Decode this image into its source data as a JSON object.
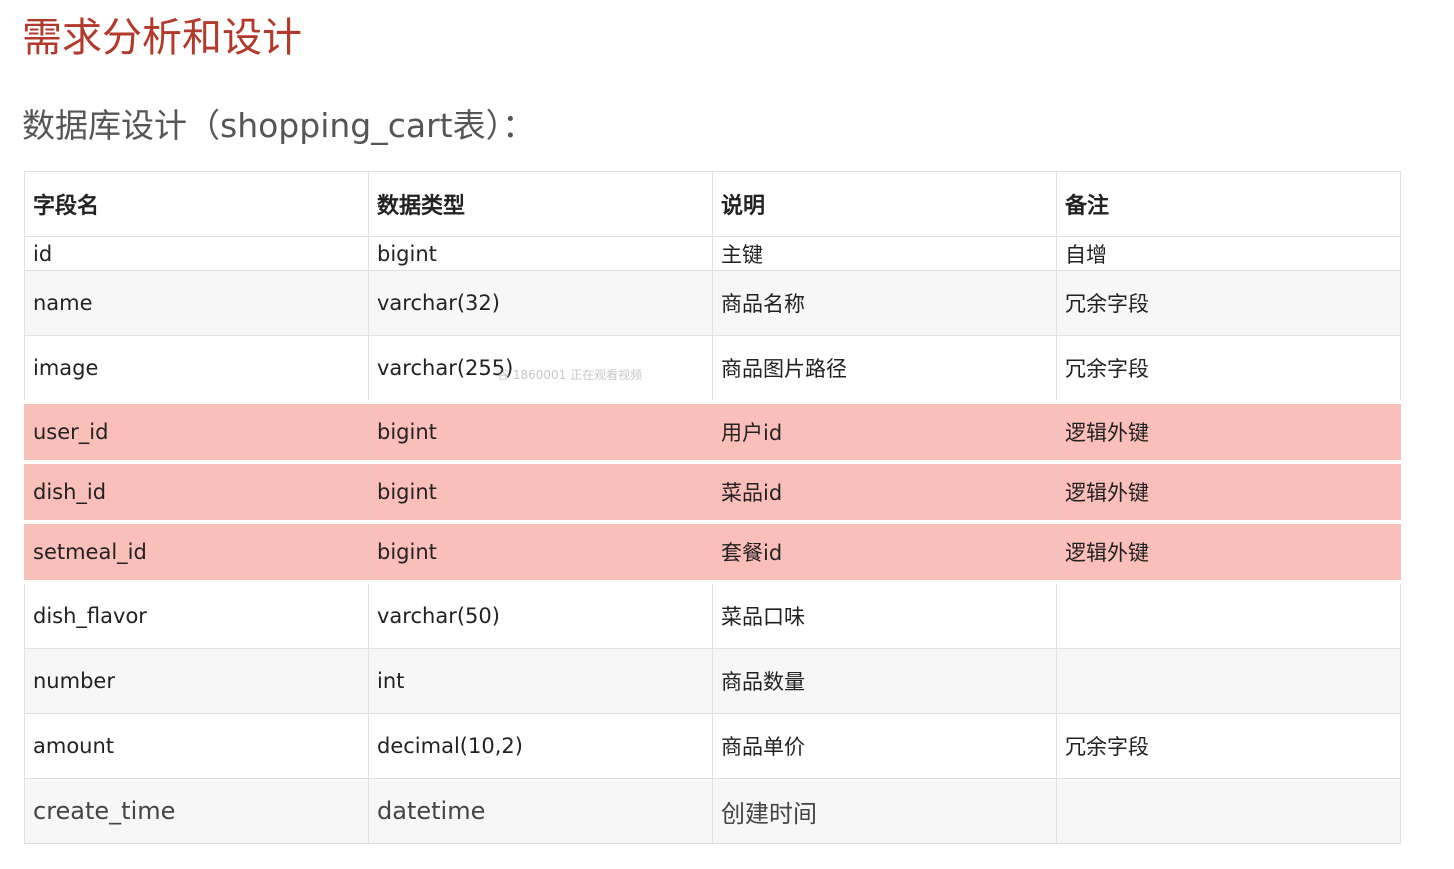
{
  "title": "需求分析和设计",
  "subtitle": "数据库设计（shopping_cart表）：",
  "table": {
    "headers": [
      "字段名",
      "数据类型",
      "说明",
      "备注"
    ],
    "rows": [
      [
        "id",
        "bigint",
        "主键",
        "自增"
      ],
      [
        "name",
        "varchar(32)",
        "商品名称",
        "冗余字段"
      ],
      [
        "image",
        "varchar(255)",
        "商品图片路径",
        "冗余字段"
      ],
      [
        "user_id",
        "bigint",
        "用户id",
        "逻辑外键"
      ],
      [
        "dish_id",
        "bigint",
        "菜品id",
        "逻辑外键"
      ],
      [
        "setmeal_id",
        "bigint",
        "套餐id",
        "逻辑外键"
      ],
      [
        "dish_flavor",
        "varchar(50)",
        "菜品口味",
        ""
      ],
      [
        "number",
        "int",
        "商品数量",
        ""
      ],
      [
        "amount",
        "decimal(10,2)",
        "商品单价",
        "冗余字段"
      ],
      [
        "create_time",
        "datetime",
        "创建时间",
        ""
      ]
    ]
  },
  "watermark": "谷 1860001 正在观看视频",
  "colors": {
    "title": "#b23a2a",
    "highlight_row": "#fbbfba"
  }
}
